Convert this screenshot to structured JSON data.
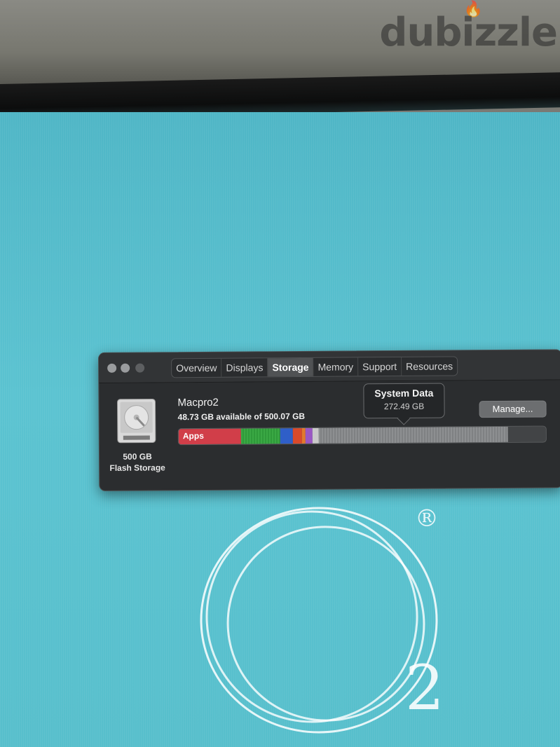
{
  "watermark": {
    "text": "dubizzle"
  },
  "wallpaper": {
    "registered_mark": "®",
    "subscript": "2"
  },
  "window": {
    "tabs": [
      {
        "label": "Overview",
        "active": false
      },
      {
        "label": "Displays",
        "active": false
      },
      {
        "label": "Storage",
        "active": true
      },
      {
        "label": "Memory",
        "active": false
      },
      {
        "label": "Support",
        "active": false
      },
      {
        "label": "Resources",
        "active": false
      }
    ],
    "drive": {
      "capacity": "500 GB",
      "type": "Flash Storage",
      "icon": "hard-drive-icon"
    },
    "disk": {
      "name": "Macpro2",
      "available": "48.73 GB available of 500.07 GB"
    },
    "tooltip": {
      "title": "System Data",
      "value": "272.49 GB"
    },
    "manage_label": "Manage...",
    "storage_bar": {
      "apps_label": "Apps",
      "segments": [
        {
          "category": "apps",
          "color": "#d13e49",
          "fraction": 0.169
        },
        {
          "category": "green",
          "color": "#3aa844",
          "fraction": 0.107
        },
        {
          "category": "blue",
          "color": "#2f5fc8",
          "fraction": 0.036
        },
        {
          "category": "red",
          "color": "#d94a2b",
          "fraction": 0.023
        },
        {
          "category": "orange",
          "color": "#e17a2e",
          "fraction": 0.011
        },
        {
          "category": "purple",
          "color": "#9a57c4",
          "fraction": 0.019
        },
        {
          "category": "light",
          "color": "#c9c9c9",
          "fraction": 0.017
        },
        {
          "category": "system-data",
          "color": "#8d8f91",
          "fraction": 0.515
        }
      ]
    }
  }
}
